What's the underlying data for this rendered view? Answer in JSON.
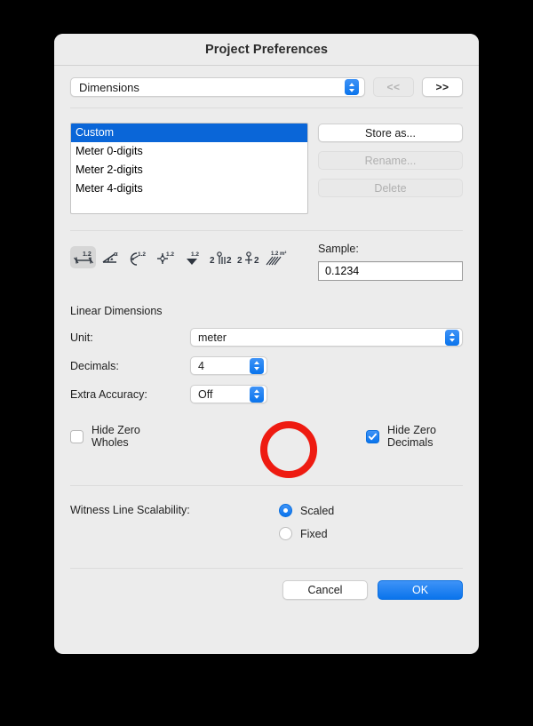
{
  "window": {
    "title": "Project Preferences"
  },
  "category": {
    "selected": "Dimensions",
    "prev_label": "<<",
    "next_label": ">>",
    "prev_enabled": false,
    "next_enabled": true
  },
  "presets": {
    "items": [
      {
        "label": "Custom",
        "selected": true
      },
      {
        "label": "Meter 0-digits",
        "selected": false
      },
      {
        "label": "Meter 2-digits",
        "selected": false
      },
      {
        "label": "Meter 4-digits",
        "selected": false
      }
    ],
    "buttons": [
      {
        "label": "Store as...",
        "enabled": true
      },
      {
        "label": "Rename...",
        "enabled": false
      },
      {
        "label": "Delete",
        "enabled": false
      }
    ]
  },
  "icon_strip": {
    "items": [
      {
        "name": "linear-dimension-icon",
        "selected": true
      },
      {
        "name": "angular-dimension-icon",
        "selected": false
      },
      {
        "name": "radial-dimension-icon",
        "selected": false
      },
      {
        "name": "point-dimension-icon",
        "selected": false
      },
      {
        "name": "level-dimension-icon",
        "selected": false
      },
      {
        "name": "elevation-dimension-icon",
        "selected": false
      },
      {
        "name": "elevation-alt-dimension-icon",
        "selected": false
      },
      {
        "name": "area-dimension-icon",
        "selected": false
      }
    ]
  },
  "sample": {
    "label": "Sample:",
    "value": "0.1234"
  },
  "linear": {
    "section_title": "Linear Dimensions",
    "unit_label": "Unit:",
    "unit_value": "meter",
    "decimals_label": "Decimals:",
    "decimals_value": "4",
    "extra_accuracy_label": "Extra Accuracy:",
    "extra_accuracy_value": "Off",
    "hide_zero_wholes_label": "Hide Zero Wholes",
    "hide_zero_wholes_checked": false,
    "hide_zero_decimals_label": "Hide Zero Decimals",
    "hide_zero_decimals_checked": true
  },
  "witness": {
    "label": "Witness Line Scalability:",
    "options": [
      {
        "label": "Scaled",
        "selected": true
      },
      {
        "label": "Fixed",
        "selected": false
      }
    ]
  },
  "footer": {
    "cancel_label": "Cancel",
    "ok_label": "OK"
  },
  "annotation": {
    "shape": "circle",
    "color": "#ee1b11",
    "target": "hide-zero-decimals-checkbox"
  }
}
